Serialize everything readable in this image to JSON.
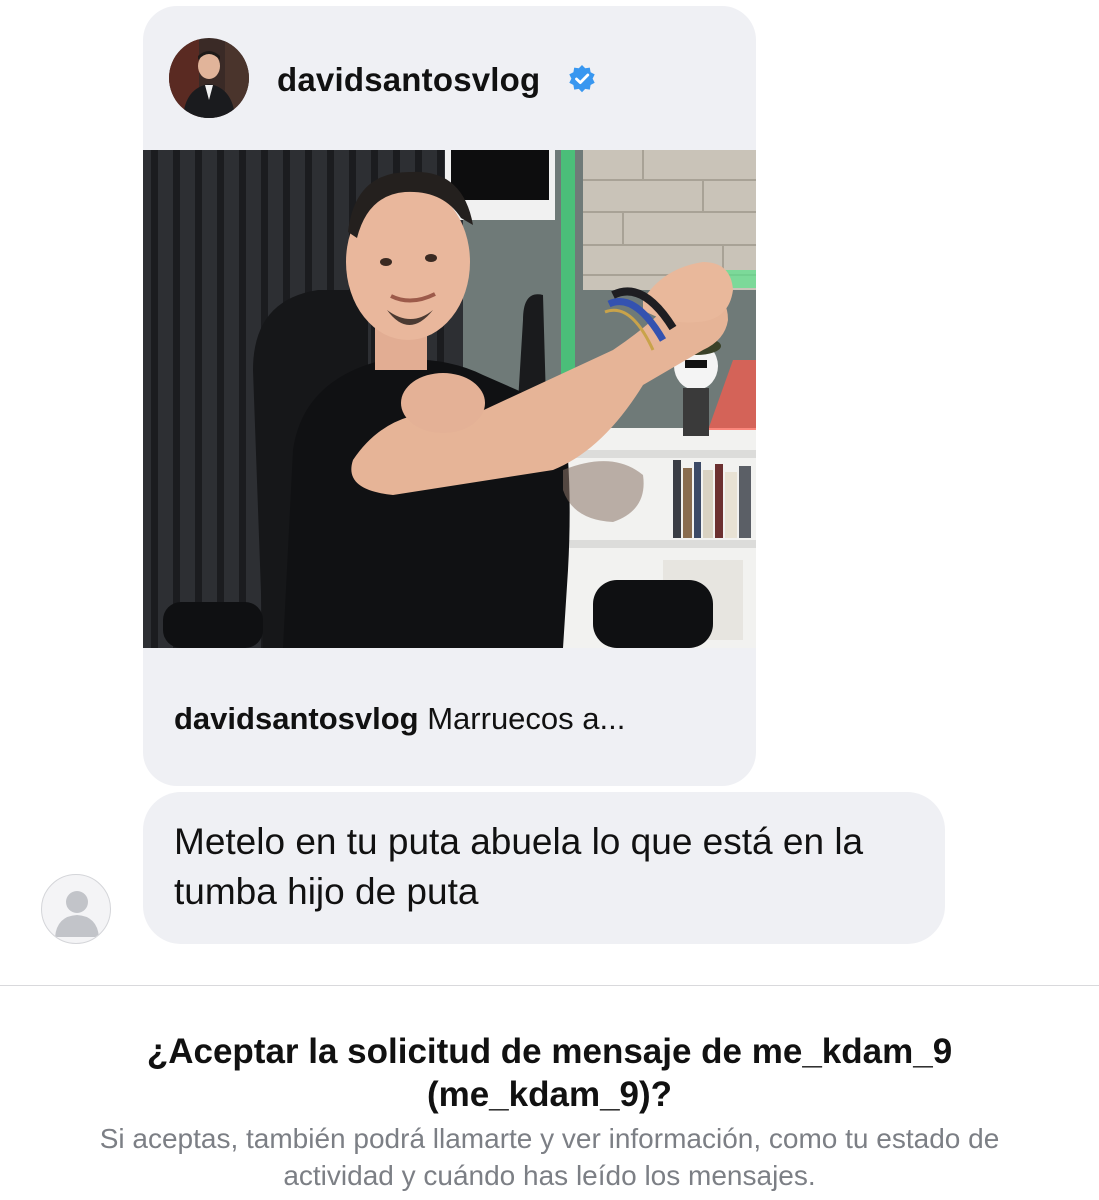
{
  "shared_post": {
    "username": "davidsantosvlog",
    "verified_icon": "verified-badge-icon",
    "verified_color": "#3897f0",
    "caption_user": "davidsantosvlog",
    "caption_text": "Marruecos a..."
  },
  "message": {
    "text": "Metelo en tu puta abuela lo que está en la tumba hijo de puta"
  },
  "sender": {
    "avatar_icon": "default-user-icon"
  },
  "request": {
    "title": "¿Aceptar la solicitud de mensaje de me_kdam_9 (me_kdam_9)?",
    "subtitle": "Si aceptas, también podrá llamarte y ver información, como tu estado de actividad y cuándo has leído los mensajes."
  }
}
